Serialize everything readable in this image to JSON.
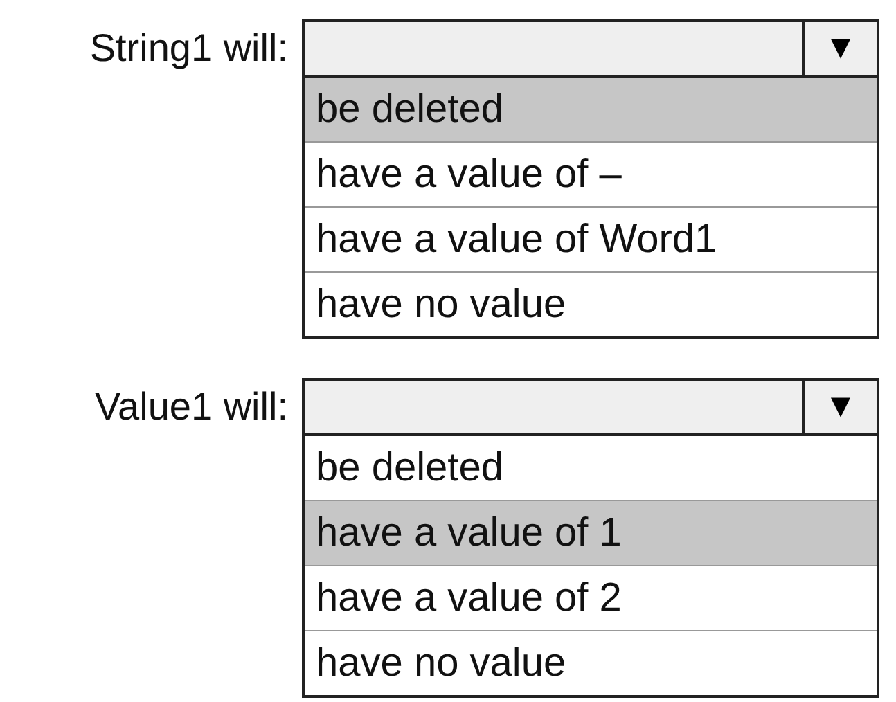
{
  "dropdowns": [
    {
      "label": "String1 will:",
      "arrow": "▼",
      "options": [
        {
          "text": "be deleted",
          "selected": true
        },
        {
          "text": "have a value of –",
          "selected": false
        },
        {
          "text": "have a value of Word1",
          "selected": false
        },
        {
          "text": "have no value",
          "selected": false
        }
      ]
    },
    {
      "label": "Value1 will:",
      "arrow": "▼",
      "options": [
        {
          "text": "be deleted",
          "selected": false
        },
        {
          "text": "have a value of 1",
          "selected": true
        },
        {
          "text": "have a value of 2",
          "selected": false
        },
        {
          "text": "have no value",
          "selected": false
        }
      ]
    }
  ]
}
